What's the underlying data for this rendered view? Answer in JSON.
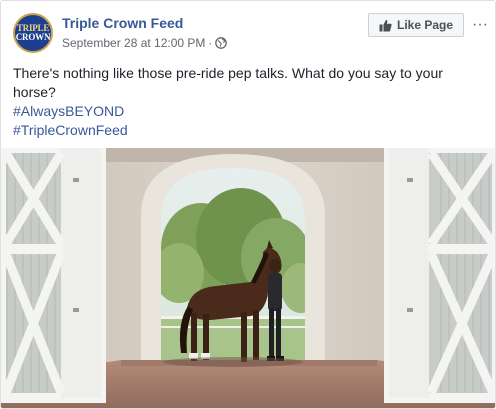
{
  "post": {
    "page_name": "Triple Crown Feed",
    "timestamp": "September 28 at 12:00 PM",
    "separator": "·",
    "privacy_icon": "globe-icon",
    "like_button_label": "Like Page",
    "like_icon": "thumbs-up-icon",
    "more_label": "···",
    "avatar": {
      "logo_line_1": "TRIPLE",
      "logo_line_2": "CROWN"
    },
    "message": "There's nothing like those pre-ride pep talks. What do you say to your horse?",
    "hashtags": [
      "#AlwaysBEYOND",
      "#TripleCrownFeed"
    ],
    "photo": {
      "description_icon": "photo-horse-barn"
    }
  },
  "colors": {
    "link": "#385898",
    "text": "#1d2129",
    "meta": "#616770",
    "button_bg": "#f5f6f7",
    "avatar_bg": "#1c3f8f",
    "avatar_gold": "#c9a44a"
  }
}
